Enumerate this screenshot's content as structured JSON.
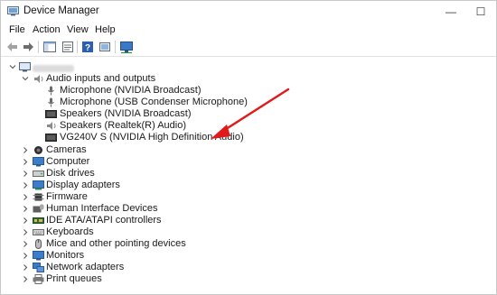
{
  "window": {
    "title": "Device Manager",
    "minimize_glyph": "—",
    "maximize_glyph": "☐"
  },
  "menu": {
    "items": [
      "File",
      "Action",
      "View",
      "Help"
    ]
  },
  "toolbar": {
    "buttons": [
      "back-icon",
      "forward-icon",
      "show-hide-console-tree-icon",
      "properties-icon",
      "help-icon",
      "update-driver-icon",
      "monitor-icon"
    ]
  },
  "tree": {
    "root": {
      "label": "",
      "icon": "computer-icon",
      "obscured": true
    },
    "expanded_category": {
      "label": "Audio inputs and outputs",
      "icon": "speaker-icon",
      "children": [
        {
          "label": "Microphone (NVIDIA Broadcast)",
          "icon": "microphone-icon"
        },
        {
          "label": "Microphone (USB Condenser Microphone)",
          "icon": "microphone-icon"
        },
        {
          "label": "Speakers (NVIDIA Broadcast)",
          "icon": "monitor-speaker-icon"
        },
        {
          "label": "Speakers (Realtek(R) Audio)",
          "icon": "speaker-icon"
        },
        {
          "label": "VG240V S (NVIDIA High Definition Audio)",
          "icon": "monitor-speaker-icon"
        }
      ]
    },
    "categories": [
      {
        "label": "Cameras",
        "icon": "camera-icon"
      },
      {
        "label": "Computer",
        "icon": "computer-icon"
      },
      {
        "label": "Disk drives",
        "icon": "disk-drive-icon"
      },
      {
        "label": "Display adapters",
        "icon": "display-adapter-icon"
      },
      {
        "label": "Firmware",
        "icon": "firmware-icon"
      },
      {
        "label": "Human Interface Devices",
        "icon": "hid-icon"
      },
      {
        "label": "IDE ATA/ATAPI controllers",
        "icon": "ide-controller-icon"
      },
      {
        "label": "Keyboards",
        "icon": "keyboard-icon"
      },
      {
        "label": "Mice and other pointing devices",
        "icon": "mouse-icon"
      },
      {
        "label": "Monitors",
        "icon": "monitor-icon"
      },
      {
        "label": "Network adapters",
        "icon": "network-adapter-icon"
      },
      {
        "label": "Print queues",
        "icon": "printer-icon"
      }
    ]
  },
  "annotation": {
    "type": "arrow",
    "color": "#e11919",
    "points_to": "VG240V S (NVIDIA High Definition Audio)"
  },
  "colors": {
    "accent": "#2b6cc4",
    "arrow": "#e11919"
  }
}
